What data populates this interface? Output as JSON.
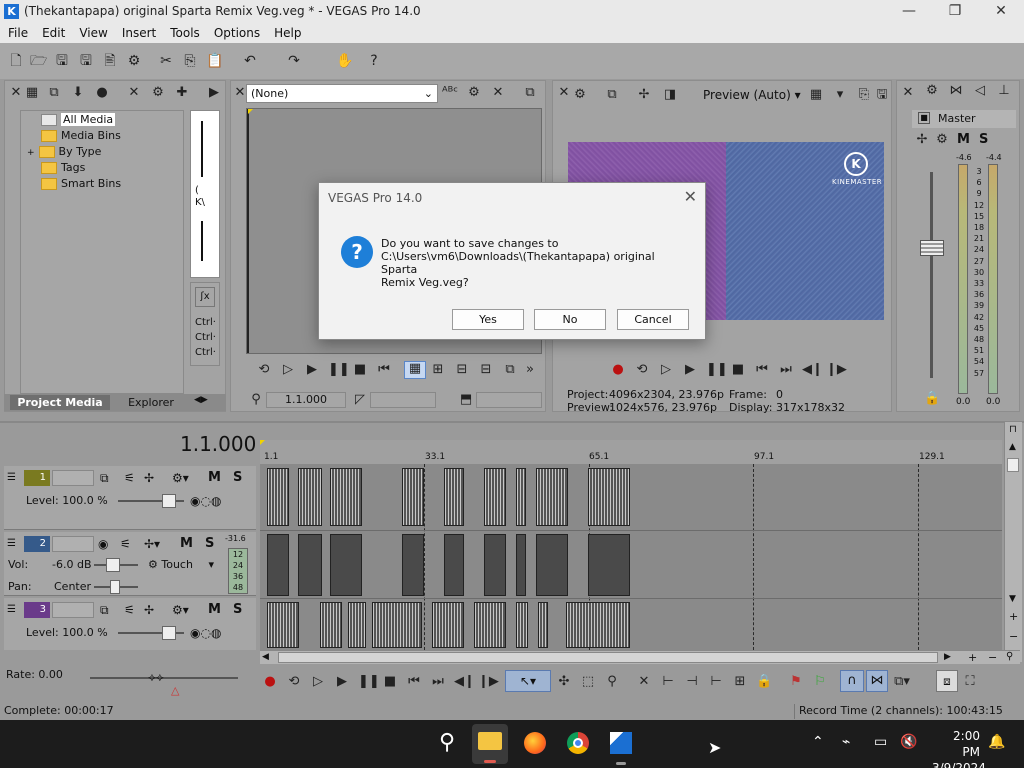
{
  "window": {
    "title": "(Thekantapapa) original Sparta Remix Veg.veg * - VEGAS Pro 14.0",
    "minimize": "—",
    "maximize": "❐",
    "close": "✕"
  },
  "menu": [
    "File",
    "Edit",
    "View",
    "Insert",
    "Tools",
    "Options",
    "Help"
  ],
  "project_media": {
    "tree": [
      "All Media",
      "Media Bins",
      "By Type",
      "Tags",
      "Smart Bins"
    ],
    "expand_glyph": "+",
    "tabs": [
      "Project Media",
      "Explorer"
    ]
  },
  "trimmer": {
    "dropdown_value": "(None)",
    "time": "1.1.000",
    "side_text": [
      "Ctrl·",
      "Ctrl·",
      "Ctrl·"
    ],
    "side_k": "(\nK\\"
  },
  "preview": {
    "quality": "Preview (Auto)",
    "brand": "KINEMASTER",
    "project_label": "Project:",
    "project_value": "4096x2304, 23.976p",
    "preview_label": "Preview:",
    "preview_value": "1024x576, 23.976p",
    "frame_label": "Frame:",
    "frame_value": "0",
    "display_label": "Display:",
    "display_value": "317x178x32"
  },
  "master": {
    "label": "Master",
    "m": "M",
    "s": "S",
    "peak_left": "-4.6",
    "peak_right": "-4.4",
    "scale": [
      "3",
      "6",
      "9",
      "12",
      "15",
      "18",
      "21",
      "24",
      "27",
      "30",
      "33",
      "36",
      "39",
      "42",
      "45",
      "48",
      "51",
      "54",
      "57"
    ],
    "bottom_left": "0.0",
    "bottom_right": "0.0"
  },
  "timeline": {
    "cursor_time": "1.1.000",
    "ruler": [
      "1.1",
      "33.1",
      "65.1",
      "97.1",
      "129.1"
    ],
    "tracks": [
      {
        "num": "1",
        "level_label": "Level:",
        "level": "100.0 %",
        "m": "M",
        "s": "S"
      },
      {
        "num": "2",
        "vol_label": "Vol:",
        "vol": "-6.0 dB",
        "pan_label": "Pan:",
        "pan": "Center",
        "touch": "Touch",
        "m": "M",
        "s": "S",
        "meter_top": "-31.6",
        "meter_scale": [
          "12",
          "24",
          "36",
          "48"
        ]
      },
      {
        "num": "3",
        "level_label": "Level:",
        "level": "100.0 %",
        "m": "M",
        "s": "S"
      }
    ],
    "rate_label": "Rate: 0.00"
  },
  "status": {
    "complete": "Complete: 00:00:17",
    "record_time": "Record Time (2 channels): 100:43:15"
  },
  "dialog": {
    "title": "VEGAS Pro 14.0",
    "close": "✕",
    "icon": "?",
    "line1": "Do you want to save changes to",
    "line2": "C:\\Users\\vm6\\Downloads\\(Thekantapapa) original Sparta",
    "line3": "Remix Veg.veg?",
    "yes": "Yes",
    "no": "No",
    "cancel": "Cancel"
  },
  "taskbar": {
    "time": "2:00 PM",
    "date": "3/9/2024"
  },
  "colors": {
    "accent": "#1e7fd8",
    "panel": "#a3a3a3",
    "taskbar": "#1c1c1c"
  }
}
